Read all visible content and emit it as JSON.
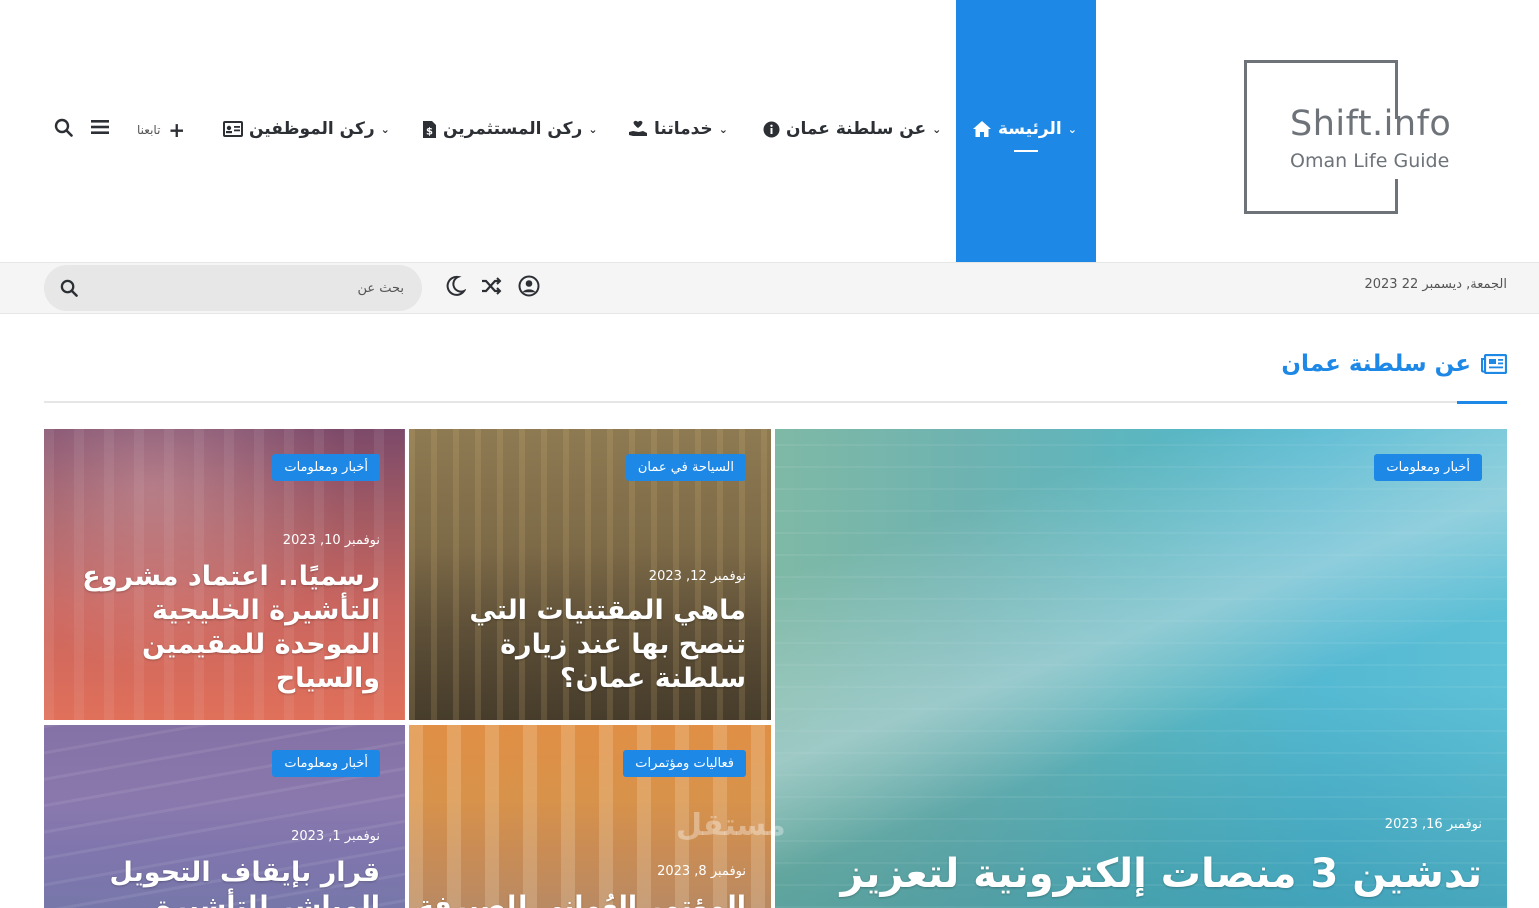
{
  "logo": {
    "title": "Shift.info",
    "subtitle": "Oman Life Guide"
  },
  "nav": {
    "home": "الرئيسة",
    "about": "عن سلطنة عمان",
    "services": "خدماتنا",
    "investors": "ركن المستثمرين",
    "employees": "ركن الموظفين",
    "follow": "تابعنا"
  },
  "topbar": {
    "date": "الجمعة, ديسمبر 22 2023",
    "search_placeholder": "بحث عن"
  },
  "section": {
    "title": "عن سلطنة عمان"
  },
  "posts": [
    {
      "category": "أخبار ومعلومات",
      "date": "نوفمبر 16, 2023",
      "title": "تدشين 3 منصات إلكترونية لتعزيز"
    },
    {
      "category": "السياحة في عمان",
      "date": "نوفمبر 12, 2023",
      "title": "ماهي المقتنيات التي تنصح بها عند زيارة سلطنة عمان؟"
    },
    {
      "category": "أخبار ومعلومات",
      "date": "نوفمبر 10, 2023",
      "title": "رسميًا.. اعتماد مشروع التأشيرة الخليجية الموحدة للمقيمين والسياح"
    },
    {
      "category": "فعاليات ومؤتمرات",
      "date": "نوفمبر 8, 2023",
      "title": "المؤتمر العُماني للصيرفة"
    },
    {
      "category": "أخبار ومعلومات",
      "date": "نوفمبر 1, 2023",
      "title": "قرار بإيقاف التحويل المباشر للتأشيرة"
    }
  ],
  "watermark": "مستقل",
  "colors": {
    "accent": "#1d88e5",
    "text": "#2c2f34",
    "topbar_bg": "#f5f5f5"
  }
}
